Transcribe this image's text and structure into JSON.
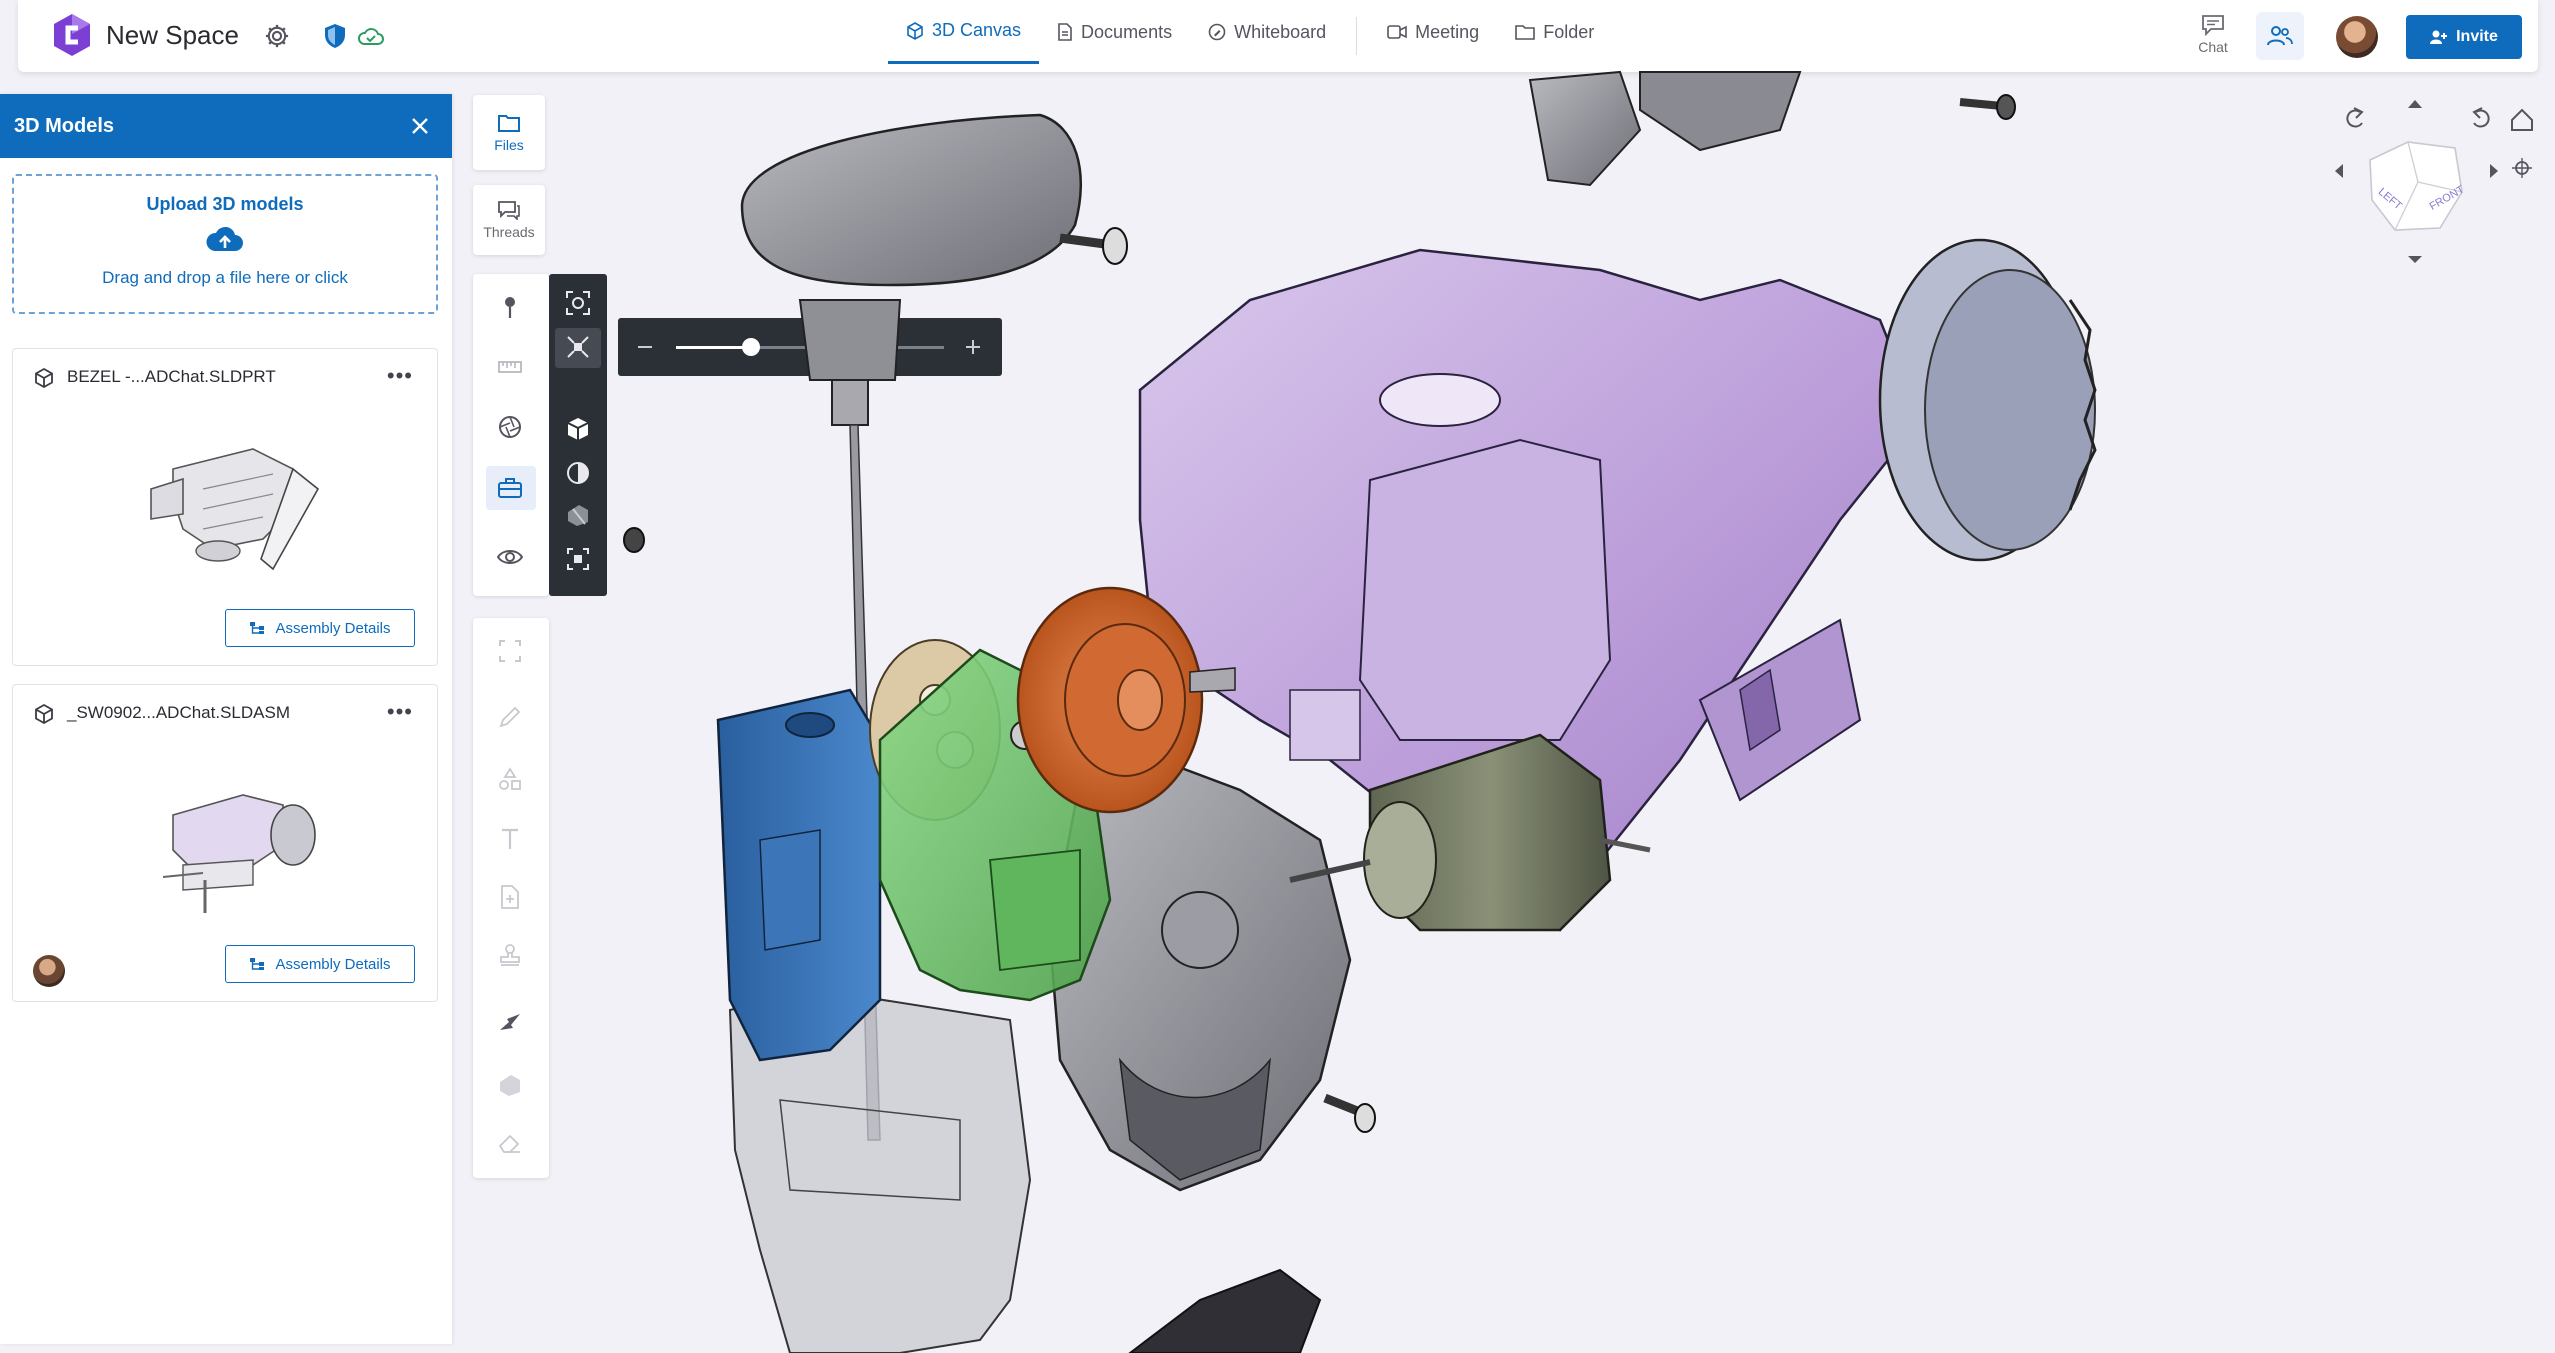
{
  "app": {
    "space_title": "New Space"
  },
  "tabs": [
    {
      "label": "3D Canvas",
      "icon": "cube-icon",
      "active": true
    },
    {
      "label": "Documents",
      "icon": "document-icon"
    },
    {
      "label": "Whiteboard",
      "icon": "whiteboard-icon"
    },
    {
      "label": "Meeting",
      "icon": "video-icon"
    },
    {
      "label": "Folder",
      "icon": "folder-icon"
    }
  ],
  "header": {
    "chat_label": "Chat",
    "invite_label": "Invite"
  },
  "panel": {
    "title": "3D Models",
    "upload_title": "Upload 3D models",
    "upload_hint": "Drag and drop a file here or click",
    "models": [
      {
        "name": "BEZEL -...ADChat.SLDPRT",
        "action": "Assembly Details"
      },
      {
        "name": "_SW0902...ADChat.SLDASM",
        "action": "Assembly Details"
      }
    ]
  },
  "rail": {
    "files_label": "Files",
    "threads_label": "Threads"
  },
  "colors": {
    "accent": "#0f6cbd",
    "housing_purple": "#c6b0dd",
    "block_blue": "#2e6fb8",
    "bracket_green": "#6cc06a",
    "gear_orange": "#d8692e",
    "toolbar_dark": "#2b2f36"
  },
  "slider": {
    "value_fraction": 0.28
  }
}
